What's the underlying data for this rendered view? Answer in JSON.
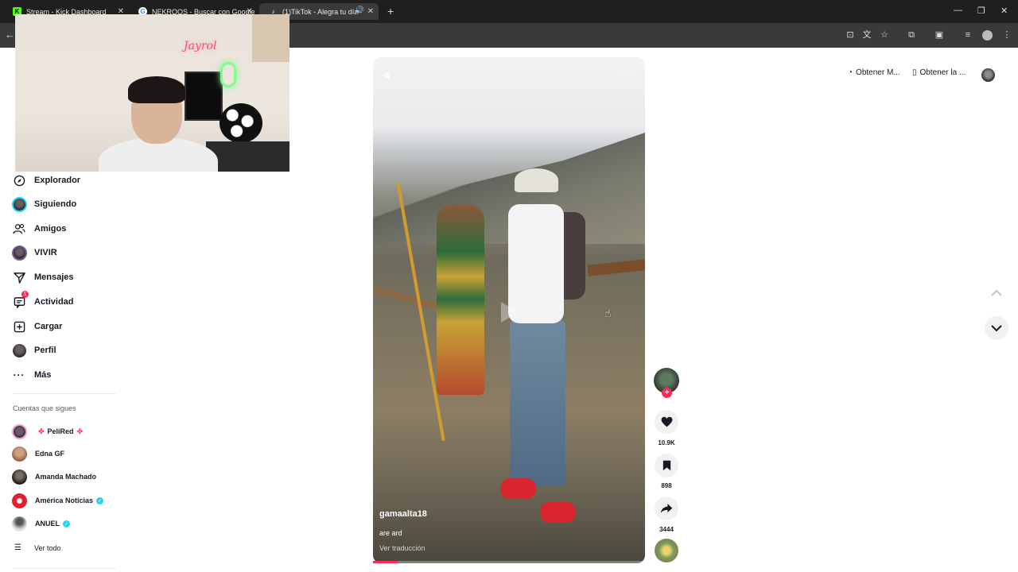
{
  "browser": {
    "tabs": [
      {
        "title": "Stream - Kick Dashboard",
        "favicon": "kick-icon",
        "color": "#53fc18"
      },
      {
        "title": "NEKROOS - Buscar con Google",
        "favicon": "google-icon",
        "color": "#4285f4"
      },
      {
        "title": "(1)TikTok - Alegra tu día",
        "favicon": "tiktok-icon",
        "color": "#ffffff"
      }
    ],
    "active_tab": 2
  },
  "webcam": {
    "sign_text": "Jayrol"
  },
  "sidebar": {
    "items": [
      {
        "label": "Explorador",
        "icon": "compass-icon"
      },
      {
        "label": "Siguiendo",
        "icon": "avatar-icon"
      },
      {
        "label": "Amigos",
        "icon": "friends-icon"
      },
      {
        "label": "VIVIR",
        "icon": "live-avatar-icon"
      },
      {
        "label": "Mensajes",
        "icon": "paper-plane-icon"
      },
      {
        "label": "Actividad",
        "icon": "activity-icon",
        "badge": "1"
      },
      {
        "label": "Cargar",
        "icon": "upload-icon"
      },
      {
        "label": "Perfil",
        "icon": "profile-icon"
      },
      {
        "label": "Más",
        "icon": "more-icon"
      }
    ],
    "following_title": "Cuentas que sigues",
    "following": [
      {
        "name": "PeliRed",
        "color": "#5a4a5c"
      },
      {
        "name": "Edna GF",
        "color": "#a57b5c"
      },
      {
        "name": "Amanda Machado",
        "color": "#2e2b2b"
      },
      {
        "name": "América Noticias",
        "color": "#e0202b",
        "verified": true
      },
      {
        "name": "ANUEL",
        "color": "#c9c9c9",
        "verified": true
      }
    ],
    "see_all": "Ver todo"
  },
  "video": {
    "username": "gamaalta18",
    "caption": "are ard",
    "translate": "Ver traducción",
    "progress": 0.09
  },
  "actions": {
    "likes": "10.9K",
    "saves": "898",
    "shares": "3444"
  },
  "topright": {
    "get_app_1": "Obtener M...",
    "get_app_2": "Obtener la ..."
  },
  "colors": {
    "accent": "#fe2c55",
    "verified": "#20d5ec",
    "text": "#161823"
  }
}
